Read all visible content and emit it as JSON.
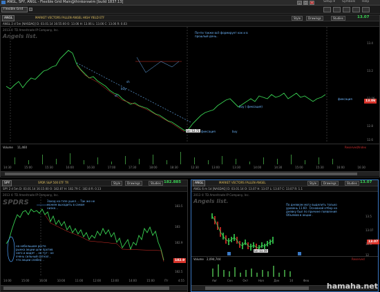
{
  "window": {
    "title": "ANGL, SPY, ANGL - Flexible Grid Main@thinkorswim [build 1837.13]"
  },
  "grid": {
    "label": "Flexible Grid"
  },
  "top": {
    "symbol": "ANGL",
    "company": "MARKET VECTORS FALLEN ANGEL HIGH YIELD ETF",
    "quote": "ANGL 2 d 5m [NASDAQ]   D: 03.01.14 16:55:00   O: 13.06   H: 13.06   L: 13.06   C: 13.06   R: 0.03",
    "copyright": "2013 © TD Ameritrade IP Company, Inc.",
    "watermark": "Angels list.",
    "buttons": {
      "style": "Style",
      "drawings": "Drawings",
      "studies": "Studies"
    },
    "studies_val": "13.07",
    "annotations": {
      "note1": "Почти также всё формирует как и в прошлый день..",
      "sh": "sh",
      "buy1": "buy",
      "sh2": "sh",
      "fix1": "фиксация",
      "buy2": "buy",
      "buy3": "buy ( фиксация)",
      "fix2": "фиксация"
    },
    "last": "13.06",
    "low": "Lo: 12.71",
    "y_ticks": [
      "13.4",
      "13.2",
      "13.06",
      "12.8",
      "12.6"
    ],
    "x_ticks": [
      "14:30",
      "15:00",
      "15:30",
      "16:00",
      "16:30",
      "17:00",
      "17:30",
      "18:00",
      "18:30",
      "12:30",
      "13:00",
      "13:30",
      "14:00",
      "14:30",
      "15:00",
      "15:30",
      "16:00",
      "16:30"
    ],
    "volume_label": "Volume",
    "volume_val": "11,460",
    "vol_right": "Reserved/Index"
  },
  "left": {
    "symbol": "SPY",
    "company": "SPDR S&P 500 ETF TR",
    "quote": "SPY 2 d 5m   D: 03.01.14 16:15:00   O: 182.87   H: 182.79   C: 182.8   R: 0.13",
    "copyright": "2013 © TD Ameritrade IP Company, Inc.",
    "watermark": "SPDRS",
    "buttons": {
      "style": "Style",
      "drawings": "Drawings",
      "studies": "Studies"
    },
    "studies_val": "182.885",
    "annotations": {
      "note1": "Заход на гэпе ушел ... Так же не можем выходить в самом низке...",
      "note2": "на небольшом росте рынка акции шли против него и видят .. но тут - не очень сильный сигнал , что акции слабее .."
    },
    "last": "182.9",
    "y_ticks": [
      "183.5",
      "183",
      "182.9",
      "182.5"
    ],
    "x_ticks": [
      "14:00",
      "15:00",
      "16:00",
      "10:00",
      "11:00",
      "12:00",
      "13:00",
      "14:00",
      "15:00",
      "Пт",
      "4:55"
    ]
  },
  "right": {
    "symbol": "ANGL",
    "company": "MARKET VECTORS FALLEN ANGEL",
    "quote": "ANGL 6 m 1d [NASDAQ]   D: 03.01.14   O: 13.07   H: 13.07   L: 13.07   C: 13.07   R: 1.1",
    "copyright": "2013 © TD Ameritrade IP Company, Inc.",
    "watermark": "Angels list.",
    "buttons": {
      "style": "Style",
      "drawings": "Drawings",
      "studies": "Studies"
    },
    "studies_val": "13.07",
    "annotations": {
      "note1": "По дневкам могу выделить только уровень 11.60 . Основной отбор на дневку был по причине появления Объемов в акции ."
    },
    "last": "13.07",
    "low": "Lo: 11.59",
    "y_ticks": [
      "13.5",
      "13.07",
      "12.5",
      "12"
    ],
    "x_ticks": [
      "Авг",
      "Сен",
      "Окт",
      "Ноя",
      "Дек",
      "14",
      "Фев"
    ],
    "volume_label": "Volume",
    "volume_val": "2,094,744",
    "vol_right": "Reserved"
  },
  "footer": {
    "watermark": "hamaha.net"
  },
  "colors": {
    "up": "#39d353",
    "down": "#e0302a",
    "accent": "#4fa3ff"
  }
}
